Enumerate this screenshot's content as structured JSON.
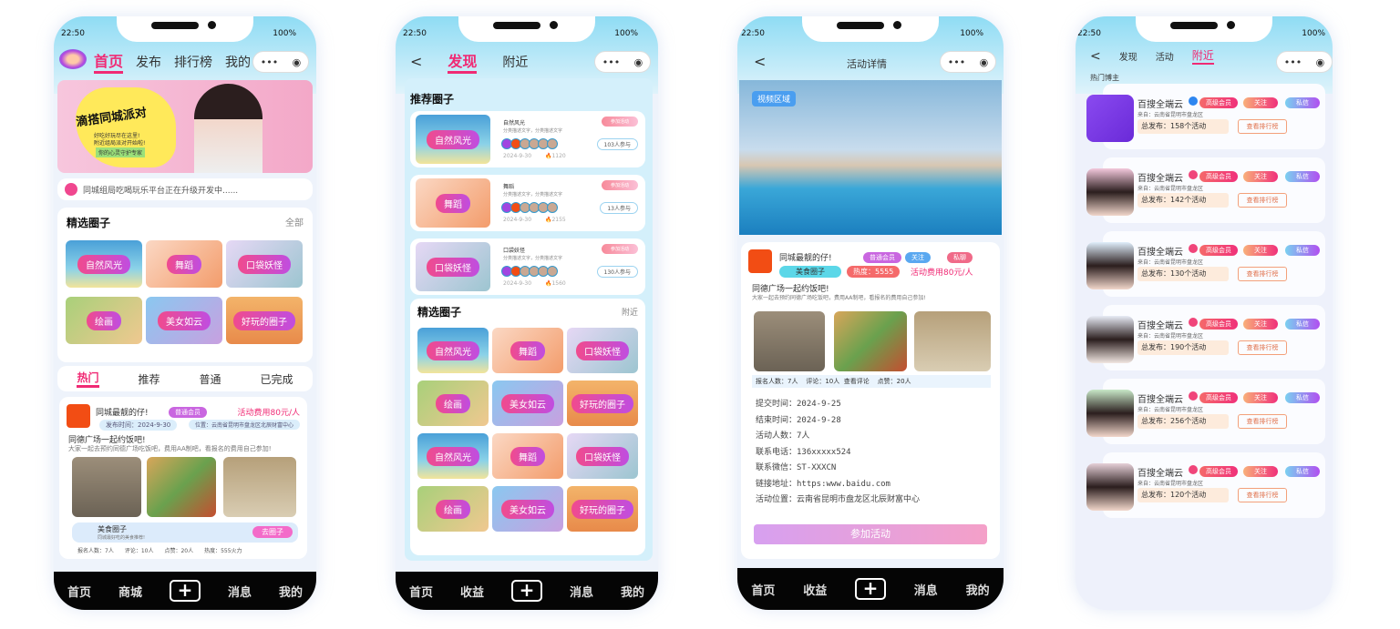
{
  "status": {
    "time": "22:50",
    "battery": "100%"
  },
  "capsule": {
    "more": "•••",
    "target": "◉"
  },
  "home": {
    "nav": [
      "首页",
      "发布",
      "排行榜",
      "我的"
    ],
    "banner": {
      "title": "滴搭同城派对",
      "line1": "好吃好玩尽在这里!",
      "line2": "附近组局派对开始啦!",
      "tag": "你的心灵守护专家"
    },
    "notice": "同城组局吃喝玩乐平台正在升级开发中......",
    "section": {
      "title": "精选圈子",
      "more": "全部"
    },
    "circles": [
      "自然风光",
      "舞蹈",
      "口袋妖怪",
      "绘画",
      "美女如云",
      "好玩的圈子"
    ],
    "tabs": [
      "热门",
      "推荐",
      "普通",
      "已完成"
    ],
    "post": {
      "user": "同城最靓的仔!",
      "member": "普通会员",
      "fee": "活动费用80元/人",
      "time": "发布时间：2024-9-30",
      "location": "位置：云南省昆明市盘龙区北辰财富中心",
      "title": "同德广场一起约饭吧!",
      "desc": "大家一起去预约同德广场吃饭吧，费用AA制吧，看报名的费用自己参加!",
      "circle": "美食圈子",
      "circle_desc": "同城最好吃的美食推荐!",
      "go": "去圈子",
      "stats": [
        "报名人数：7人",
        "评论：10人",
        "点赞：20人",
        "热度：555火力"
      ]
    },
    "bottom": [
      "首页",
      "商城",
      "+",
      "消息",
      "我的"
    ]
  },
  "discover": {
    "nav": [
      "发现",
      "附近"
    ],
    "rec_title": "推荐圈子",
    "rec": [
      {
        "cover": "自然风光",
        "name": "自然风光",
        "desc": "分类描述文字，分类描述文字",
        "date": "2024-9-30",
        "hot": "1120",
        "join": "参加活动",
        "count": "103人参与"
      },
      {
        "cover": "舞蹈",
        "name": "舞蹈",
        "desc": "分类描述文字，分类描述文字",
        "date": "2024-9-30",
        "hot": "2155",
        "join": "参加活动",
        "count": "13人参与"
      },
      {
        "cover": "口袋妖怪",
        "name": "口袋妖怪",
        "desc": "分类描述文字，分类描述文字",
        "date": "2024-9-30",
        "hot": "1560",
        "join": "参加活动",
        "count": "130人参与"
      }
    ],
    "sel_title": "精选圈子",
    "sel_more": "附近",
    "circles": [
      "自然风光",
      "舞蹈",
      "口袋妖怪",
      "绘画",
      "美女如云",
      "好玩的圈子",
      "自然风光",
      "舞蹈",
      "口袋妖怪",
      "绘画",
      "美女如云",
      "好玩的圈子"
    ],
    "bottom": [
      "首页",
      "收益",
      "+",
      "消息",
      "我的"
    ]
  },
  "detail": {
    "title": "活动详情",
    "video": "视频区域",
    "user": "同城最靓的仔!",
    "member": "普通会员",
    "follow": "关注",
    "chat": "私聊",
    "circle": "美食圈子",
    "heat": "热度：5555",
    "fee": "活动费用80元/人",
    "post_title": "同德广场一起约饭吧!",
    "desc": "大家一起去预约同德广场吃饭吧，费用AA制吧，看报名的费用自己参加!",
    "stats": "报名人数：7人    评论：10人  查看评论    点赞：20人",
    "fields": [
      "提交时间：2024-9-25",
      "结束时间：2024-9-28",
      "活动人数：7人",
      "联系电话：136xxxxx524",
      "联系微信：ST-XXXCN",
      "链接地址：https:www.baidu.com",
      "活动位置：云南省昆明市盘龙区北辰财富中心"
    ],
    "join": "参加活动",
    "bottom": [
      "首页",
      "收益",
      "+",
      "消息",
      "我的"
    ]
  },
  "nearby": {
    "nav": [
      "发现",
      "活动",
      "附近"
    ],
    "section": "热门博主",
    "users": [
      {
        "name": "百搜全端云",
        "gender": "male",
        "from": "来自：云南省昆明市盘龙区",
        "total": "总发布：158个活动"
      },
      {
        "name": "百搜全端云",
        "gender": "female",
        "from": "来自：云南省昆明市盘龙区",
        "total": "总发布：142个活动"
      },
      {
        "name": "百搜全端云",
        "gender": "female",
        "from": "来自：云南省昆明市盘龙区",
        "total": "总发布：130个活动"
      },
      {
        "name": "百搜全端云",
        "gender": "female",
        "from": "来自：云南省昆明市盘龙区",
        "total": "总发布：190个活动"
      },
      {
        "name": "百搜全端云",
        "gender": "female",
        "from": "来自：云南省昆明市盘龙区",
        "total": "总发布：256个活动"
      },
      {
        "name": "百搜全端云",
        "gender": "female",
        "from": "来自：云南省昆明市盘龙区",
        "total": "总发布：120个活动"
      }
    ],
    "vip": "高级会员",
    "follow": "关注",
    "chat": "私信",
    "rank": "查看排行榜"
  },
  "colors": {
    "accent": "#f02a74",
    "bottom_bar": "#050505",
    "join_button": "#d7a0f0"
  }
}
